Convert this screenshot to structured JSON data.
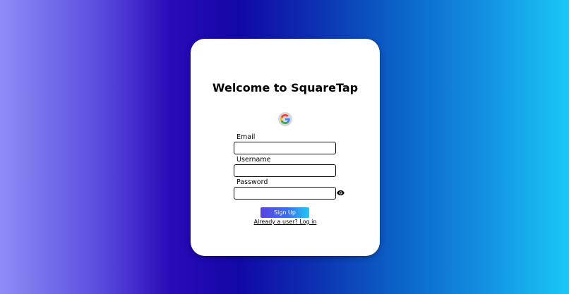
{
  "signup": {
    "title": "Welcome to SquareTap",
    "google_icon": "google-logo-icon",
    "fields": {
      "email": {
        "label": "Email",
        "value": "",
        "placeholder": ""
      },
      "username": {
        "label": "Username",
        "value": "",
        "placeholder": ""
      },
      "password": {
        "label": "Password",
        "value": "",
        "placeholder": ""
      }
    },
    "password_toggle_icon": "eye-icon",
    "submit_label": "Sign Up",
    "login_link": "Already a user? Log in"
  },
  "colors": {
    "background_left": "#8f8cf7",
    "background_mid": "#1208a8",
    "background_right": "#19c8f6",
    "button_gradient_start": "#5a44e0",
    "button_gradient_end": "#1fc8f4",
    "card": "#ffffff"
  }
}
